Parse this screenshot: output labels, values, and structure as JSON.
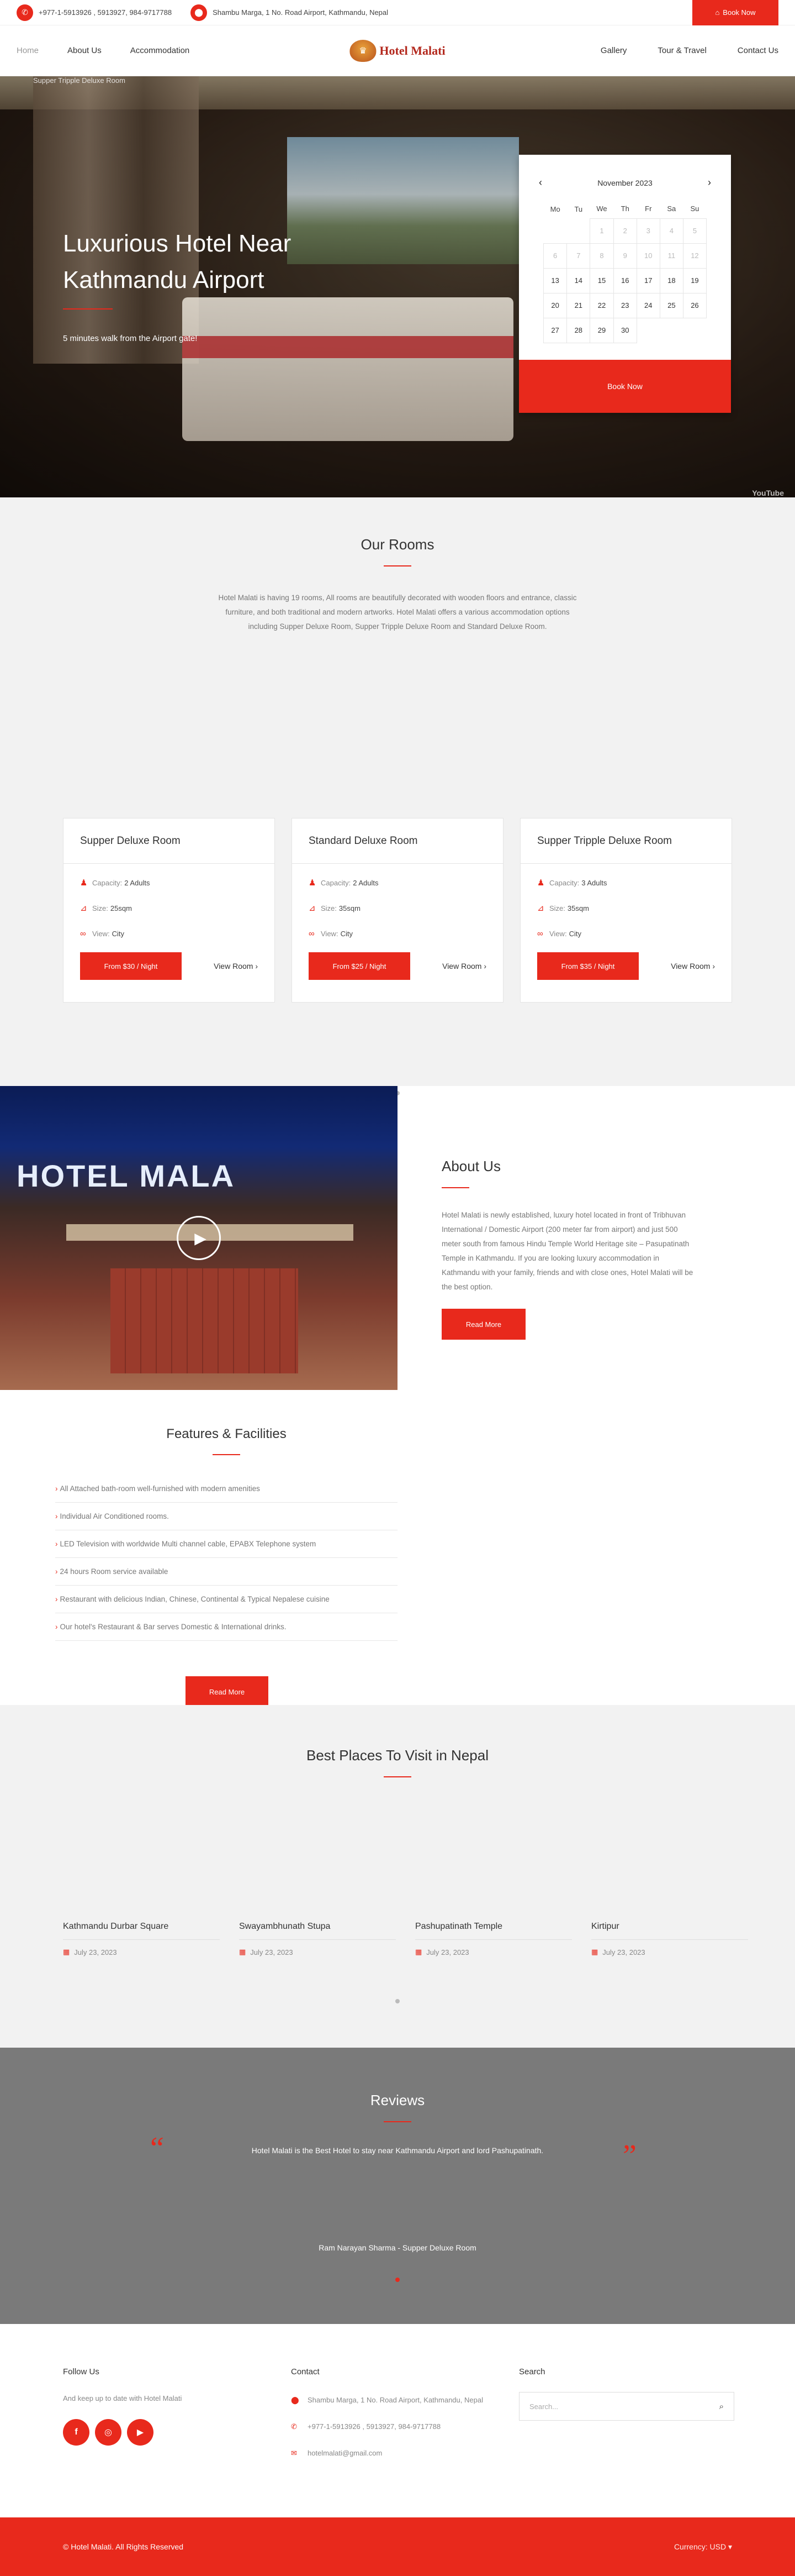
{
  "colors": {
    "accent": "#e8291c",
    "reviews_bg": "#7a7a7a",
    "section_bg": "#f2f2f2"
  },
  "topbar": {
    "phone": "+977-1-5913926 , 5913927, 984-9717788",
    "address": "Shambu Marga, 1 No. Road Airport, Kathmandu, Nepal",
    "book_label": "Book Now",
    "phone_icon": "phone-icon",
    "location_icon": "location-pin-icon"
  },
  "nav": {
    "left": [
      "Home",
      "About Us",
      "Accommodation"
    ],
    "right": [
      "Gallery",
      "Tour & Travel",
      "Contact Us"
    ],
    "logo_text": "Hotel Malati"
  },
  "hero": {
    "video_title": "Supper Tripple Deluxe Room",
    "title": "Luxurious Hotel Near Kathmandu Airport",
    "subtitle": "5 minutes walk from the Airport gate!",
    "youtube": "YouTube"
  },
  "calendar": {
    "month": "November 2023",
    "weekdays": [
      "Mo",
      "Tu",
      "We",
      "Th",
      "Fr",
      "Sa",
      "Su"
    ],
    "weeks": [
      [
        "",
        "",
        "1",
        "2",
        "3",
        "4",
        "5"
      ],
      [
        "6",
        "7",
        "8",
        "9",
        "10",
        "11",
        "12"
      ],
      [
        "13",
        "14",
        "15",
        "16",
        "17",
        "18",
        "19"
      ],
      [
        "20",
        "21",
        "22",
        "23",
        "24",
        "25",
        "26"
      ],
      [
        "27",
        "28",
        "29",
        "30",
        "",
        "",
        ""
      ]
    ],
    "book_label": "Book Now"
  },
  "rooms": {
    "title": "Our Rooms",
    "intro": "Hotel Malati  is having 19 rooms, All rooms are beautifully decorated with wooden floors and entrance, classic furniture, and both traditional and modern artworks. Hotel Malati offers a various accommodation options including Supper Deluxe Room, Supper Tripple Deluxe Room and Standard Deluxe Room.",
    "cards": [
      {
        "name": "Supper Deluxe Room",
        "capacity": "2 Adults",
        "size": "25sqm",
        "view": "City",
        "price": "From $30 / Night",
        "view_label": "View Room"
      },
      {
        "name": "Standard Deluxe Room",
        "capacity": "2 Adults",
        "size": "35sqm",
        "view": "City",
        "price": "From $25 / Night",
        "view_label": "View Room"
      },
      {
        "name": "Supper Tripple Deluxe Room",
        "capacity": "3 Adults",
        "size": "35sqm",
        "view": "City",
        "price": "From $35 / Night",
        "view_label": "View Room"
      }
    ],
    "labels": {
      "capacity": "Capacity:",
      "size": "Size:",
      "view": "View:"
    }
  },
  "about": {
    "sign": "HOTEL MALA",
    "title": "About Us",
    "text": "Hotel Malati is newly established, luxury hotel located in front of Tribhuvan International / Domestic Airport (200 meter far from airport) and just 500 meter south from famous Hindu Temple World Heritage site – Pasupatinath Temple in Kathmandu. If you are looking luxury accommodation in Kathmandu with your family, friends and with close ones, Hotel Malati will be the best option.",
    "button": "Read More"
  },
  "features": {
    "title": "Features & Facilities",
    "items": [
      "All Attached bath-room well-furnished with modern amenities",
      "Individual Air Conditioned rooms.",
      "LED Television with worldwide Multi channel cable, EPABX Telephone system",
      "24 hours Room service available",
      "Restaurant with delicious Indian, Chinese, Continental & Typical Nepalese cuisine",
      "Our hotel's Restaurant & Bar serves Domestic & International drinks."
    ],
    "button": "Read More"
  },
  "places": {
    "title": "Best Places To Visit in Nepal",
    "items": [
      {
        "name": "Kathmandu Durbar Square",
        "date": "July 23, 2023"
      },
      {
        "name": "Swayambhunath Stupa",
        "date": "July 23, 2023"
      },
      {
        "name": "Pashupatinath Temple",
        "date": "July 23, 2023"
      },
      {
        "name": "Kirtipur",
        "date": "July 23, 2023"
      }
    ]
  },
  "reviews": {
    "title": "Reviews",
    "text": "Hotel Malati is the Best Hotel to stay near Kathmandu Airport and lord Pashupatinath.",
    "author": "Ram Narayan Sharma - Supper Deluxe Room"
  },
  "footer": {
    "follow_title": "Follow Us",
    "follow_text": "And keep up to date with Hotel Malati",
    "contact_title": "Contact",
    "address": "Shambu Marga, 1 No. Road Airport, Kathmandu, Nepal",
    "phone": "+977-1-5913926 , 5913927, 984-9717788",
    "email": "hotelmalati@gmail.com",
    "search_title": "Search",
    "search_placeholder": "Search...",
    "copyright": "© Hotel Malati. All Rights Reserved",
    "currency": "Currency:  USD ▾"
  }
}
